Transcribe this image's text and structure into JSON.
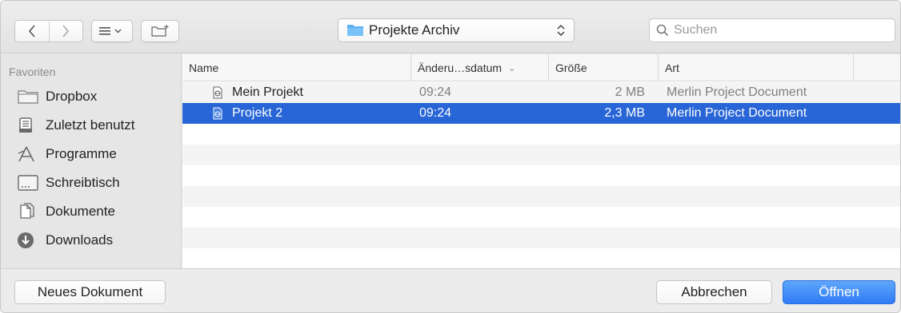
{
  "toolbar": {
    "location": "Projekte Archiv",
    "search_placeholder": "Suchen"
  },
  "sidebar": {
    "title": "Favoriten",
    "items": [
      {
        "label": "Dropbox",
        "icon": "folder-icon"
      },
      {
        "label": "Zuletzt benutzt",
        "icon": "recents-icon"
      },
      {
        "label": "Programme",
        "icon": "applications-icon"
      },
      {
        "label": "Schreibtisch",
        "icon": "desktop-icon"
      },
      {
        "label": "Dokumente",
        "icon": "documents-icon"
      },
      {
        "label": "Downloads",
        "icon": "downloads-icon"
      }
    ]
  },
  "columns": {
    "name": "Name",
    "date": "Änderu…sdatum",
    "size": "Größe",
    "kind": "Art"
  },
  "files": [
    {
      "name": "Mein Projekt",
      "date": "09:24",
      "size": "2 MB",
      "kind": "Merlin Project Document",
      "selected": false
    },
    {
      "name": "Projekt 2",
      "date": "09:24",
      "size": "2,3 MB",
      "kind": "Merlin Project Document",
      "selected": true
    }
  ],
  "footer": {
    "new_document": "Neues Dokument",
    "cancel": "Abbrechen",
    "open": "Öffnen"
  },
  "colors": {
    "selection": "#2865d6",
    "primary_button": "#3b86f7"
  }
}
